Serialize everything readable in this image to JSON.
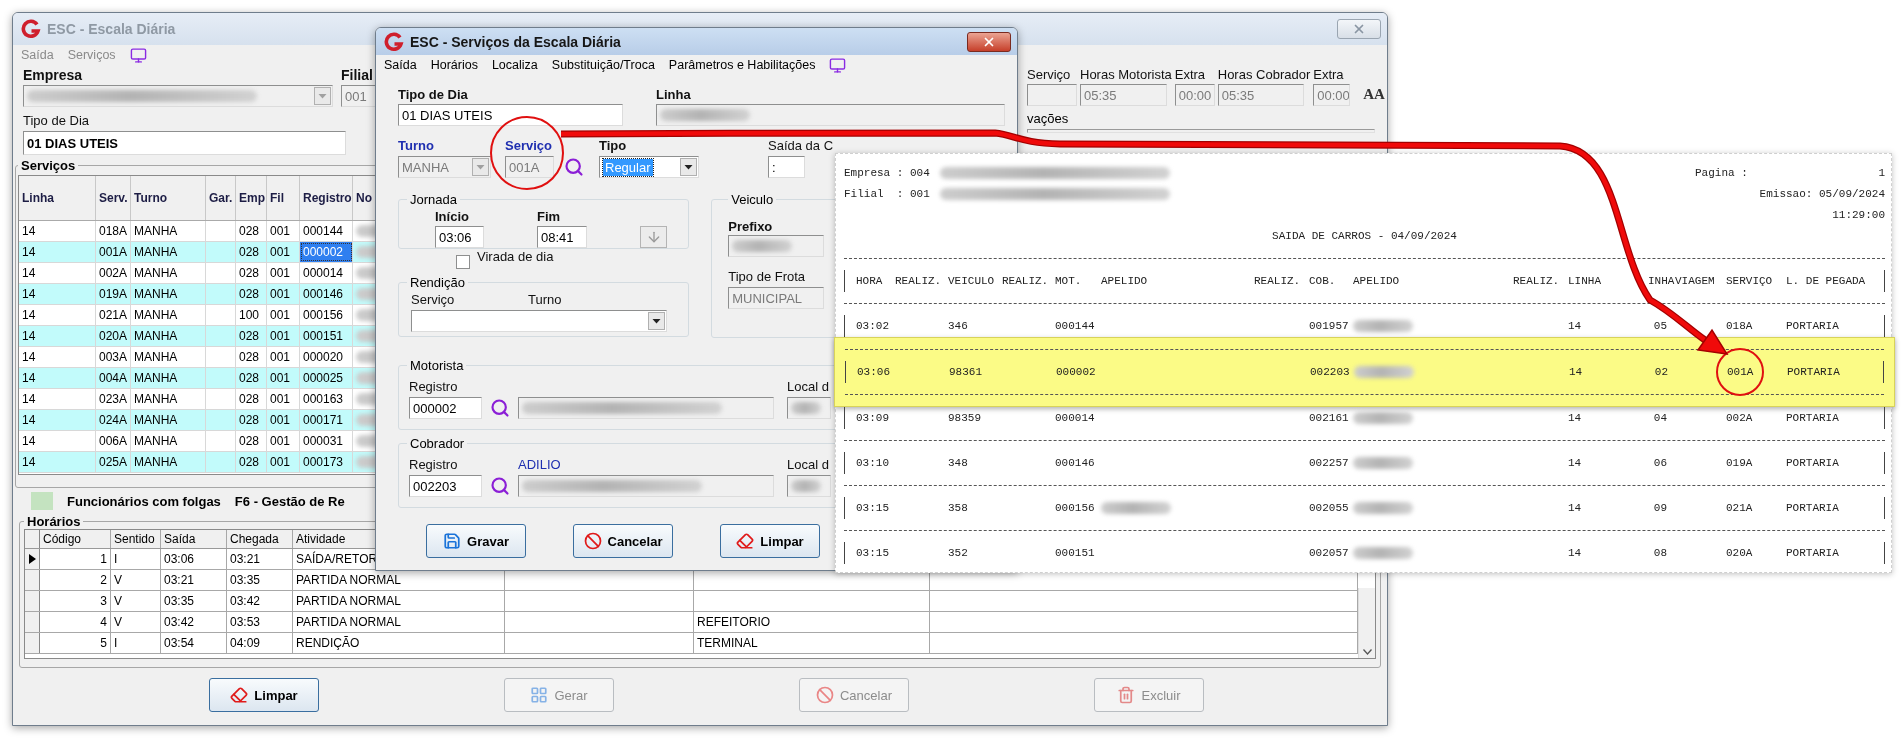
{
  "main_window": {
    "title": "ESC - Escala Diária",
    "active": false,
    "menu": [
      "Saída",
      "Serviços"
    ],
    "empresa": {
      "label": "Empresa"
    },
    "filial": {
      "label": "Filial",
      "value": "001"
    },
    "tipo_de_dia": {
      "label": "Tipo de Dia",
      "value": "01 DIAS UTEIS"
    },
    "totals": [
      {
        "label": "Serviço"
      },
      {
        "label": "Horas Motorista",
        "value": "05:35"
      },
      {
        "label": "Extra",
        "value": "00:00"
      },
      {
        "label": "Horas Cobrador",
        "value": "05:35"
      },
      {
        "label": "Extra",
        "value": "00:00"
      }
    ],
    "font_button": "AA",
    "observacoes": {
      "label": "vações"
    },
    "servicos": {
      "title": "Serviços",
      "columns": [
        "Linha",
        "Serv.",
        "Turno",
        "Gar.",
        "Emp",
        "Fil",
        "Registro",
        "No"
      ],
      "rows": [
        {
          "linha": "14",
          "serv": "018A",
          "turno": "MANHA",
          "emp": "028",
          "fil": "001",
          "registro": "000144",
          "selected": false
        },
        {
          "linha": "14",
          "serv": "001A",
          "turno": "MANHA",
          "emp": "028",
          "fil": "001",
          "registro": "000002",
          "selected": true
        },
        {
          "linha": "14",
          "serv": "002A",
          "turno": "MANHA",
          "emp": "028",
          "fil": "001",
          "registro": "000014",
          "selected": false
        },
        {
          "linha": "14",
          "serv": "019A",
          "turno": "MANHA",
          "emp": "028",
          "fil": "001",
          "registro": "000146",
          "selected": false
        },
        {
          "linha": "14",
          "serv": "021A",
          "turno": "MANHA",
          "emp": "100",
          "fil": "001",
          "registro": "000156",
          "selected": false
        },
        {
          "linha": "14",
          "serv": "020A",
          "turno": "MANHA",
          "emp": "028",
          "fil": "001",
          "registro": "000151",
          "selected": false
        },
        {
          "linha": "14",
          "serv": "003A",
          "turno": "MANHA",
          "emp": "028",
          "fil": "001",
          "registro": "000020",
          "selected": false
        },
        {
          "linha": "14",
          "serv": "004A",
          "turno": "MANHA",
          "emp": "028",
          "fil": "001",
          "registro": "000025",
          "selected": false
        },
        {
          "linha": "14",
          "serv": "023A",
          "turno": "MANHA",
          "emp": "028",
          "fil": "001",
          "registro": "000163",
          "selected": false
        },
        {
          "linha": "14",
          "serv": "024A",
          "turno": "MANHA",
          "emp": "028",
          "fil": "001",
          "registro": "000171",
          "selected": false
        },
        {
          "linha": "14",
          "serv": "006A",
          "turno": "MANHA",
          "emp": "028",
          "fil": "001",
          "registro": "000031",
          "selected": false
        },
        {
          "linha": "14",
          "serv": "025A",
          "turno": "MANHA",
          "emp": "028",
          "fil": "001",
          "registro": "000173",
          "selected": false
        }
      ]
    },
    "legend": {
      "label": "Funcionários com folgas",
      "color": "#c4e3c0"
    },
    "shortcut_hint": "F6 - Gestão de Re",
    "horarios": {
      "title": "Horários",
      "columns": [
        "Código",
        "Sentido",
        "Saída",
        "Chegada",
        "Atividade"
      ],
      "rows": [
        {
          "codigo": "1",
          "sentido": "I",
          "saida": "03:06",
          "chegada": "03:21",
          "atividade": "SAÍDA/RETOR",
          "selected": true
        },
        {
          "codigo": "2",
          "sentido": "V",
          "saida": "03:21",
          "chegada": "03:35",
          "atividade": "PARTIDA NORMAL",
          "selected": false
        },
        {
          "codigo": "3",
          "sentido": "V",
          "saida": "03:35",
          "chegada": "03:42",
          "atividade": "PARTIDA NORMAL",
          "selected": false
        },
        {
          "codigo": "4",
          "sentido": "V",
          "saida": "03:42",
          "chegada": "03:53",
          "atividade": "PARTIDA NORMAL",
          "column_7": "REFEITORIO",
          "selected": false
        },
        {
          "codigo": "5",
          "sentido": "I",
          "saida": "03:54",
          "chegada": "04:09",
          "atividade": "RENDIÇÃO",
          "column_7": "TERMINAL",
          "selected": false
        }
      ]
    },
    "buttons": [
      {
        "label": "Limpar",
        "kind": "eraser",
        "disabled": false
      },
      {
        "label": "Gerar",
        "kind": "grid",
        "disabled": true
      },
      {
        "label": "Cancelar",
        "kind": "cancel",
        "disabled": true
      },
      {
        "label": "Excluir",
        "kind": "trash",
        "disabled": true
      }
    ]
  },
  "dialog": {
    "title": "ESC - Serviços da Escala Diária",
    "active": true,
    "menu": [
      "Saída",
      "Horários",
      "Localiza",
      "Substituição/Troca",
      "Parâmetros e Habilitações"
    ],
    "tipo_de_dia": {
      "label": "Tipo de Dia",
      "value": "01 DIAS UTEIS"
    },
    "linha": {
      "label": "Linha"
    },
    "turno": {
      "label": "Turno",
      "value": "MANHA",
      "required": true,
      "disabled": true
    },
    "servico": {
      "label": "Serviço",
      "value": "001A",
      "required": true,
      "disabled": true
    },
    "tipo": {
      "label": "Tipo",
      "value": "Regular",
      "required": false,
      "disabled": false,
      "focused": true
    },
    "saida": {
      "label": "Saída da C",
      "value": ":"
    },
    "jornada": {
      "title": "Jornada",
      "inicio": {
        "label": "Início",
        "value": "03:06"
      },
      "fim": {
        "label": "Fim",
        "value": "08:41"
      }
    },
    "virada": {
      "label": "Virada de dia",
      "checked": false
    },
    "rendicao": {
      "title": "Rendição",
      "servico_label": "Serviço",
      "turno_label": "Turno"
    },
    "veiculo": {
      "title": "Veiculo",
      "prefixo_label": "Prefixo",
      "frota": {
        "label": "Tipo de Frota",
        "value": "MUNICIPAL"
      }
    },
    "motorista": {
      "title": "Motorista",
      "registro": {
        "label": "Registro",
        "value": "000002"
      },
      "local_label": "Local d"
    },
    "cobrador": {
      "title": "Cobrador",
      "registro": {
        "label": "Registro",
        "value": "002203"
      },
      "apelido": "ADILIO",
      "local_label": "Local d"
    },
    "buttons": [
      {
        "label": "Gravar",
        "kind": "save"
      },
      {
        "label": "Cancelar",
        "kind": "cancel"
      },
      {
        "label": "Limpar",
        "kind": "eraser"
      }
    ]
  },
  "report": {
    "empresa": "Empresa : 004",
    "filial": "Filial  : 001",
    "pagina_label": "Pagina :",
    "pagina": "1",
    "emissao": "Emissao: 05/09/2024",
    "hora": "11:29:00",
    "title": "SAIDA DE CARROS - 04/09/2024",
    "columns": [
      "HORA",
      "REALIZ.",
      "VEICULO",
      "REALIZ.",
      "MOT.",
      "APELIDO",
      "REALIZ.",
      "COB.",
      "APELIDO",
      "REALIZ.",
      "LINHA",
      "INHA",
      "VIAGEM",
      "SERVIÇO",
      "L. DE PEGADA"
    ],
    "rows": [
      {
        "hora": "03:02",
        "veiculo": "346",
        "mot": "000144",
        "cob": "001957",
        "linha": "14",
        "viagem": "05",
        "servico": "018A",
        "pegada": "PORTARIA",
        "highlighted": false,
        "mot_apelido_hidden": false
      },
      {
        "hora": "03:06",
        "veiculo": "98361",
        "mot": "000002",
        "cob": "002203",
        "linha": "14",
        "viagem": "02",
        "servico": "001A",
        "pegada": "PORTARIA",
        "highlighted": true,
        "mot_apelido_hidden": false
      },
      {
        "hora": "03:09",
        "veiculo": "98359",
        "mot": "000014",
        "cob": "002161",
        "linha": "14",
        "viagem": "04",
        "servico": "002A",
        "pegada": "PORTARIA",
        "highlighted": false,
        "mot_apelido_hidden": false
      },
      {
        "hora": "03:10",
        "veiculo": "348",
        "mot": "000146",
        "cob": "002257",
        "linha": "14",
        "viagem": "06",
        "servico": "019A",
        "pegada": "PORTARIA",
        "highlighted": false,
        "mot_apelido_hidden": false
      },
      {
        "hora": "03:15",
        "veiculo": "358",
        "mot": "000156",
        "cob": "002055",
        "linha": "14",
        "viagem": "09",
        "servico": "021A",
        "pegada": "PORTARIA",
        "highlighted": false,
        "mot_apelido_hidden": true
      },
      {
        "hora": "03:15",
        "veiculo": "352",
        "mot": "000151",
        "cob": "002057",
        "linha": "14",
        "viagem": "08",
        "servico": "020A",
        "pegada": "PORTARIA",
        "highlighted": false,
        "mot_apelido_hidden": false
      }
    ]
  }
}
